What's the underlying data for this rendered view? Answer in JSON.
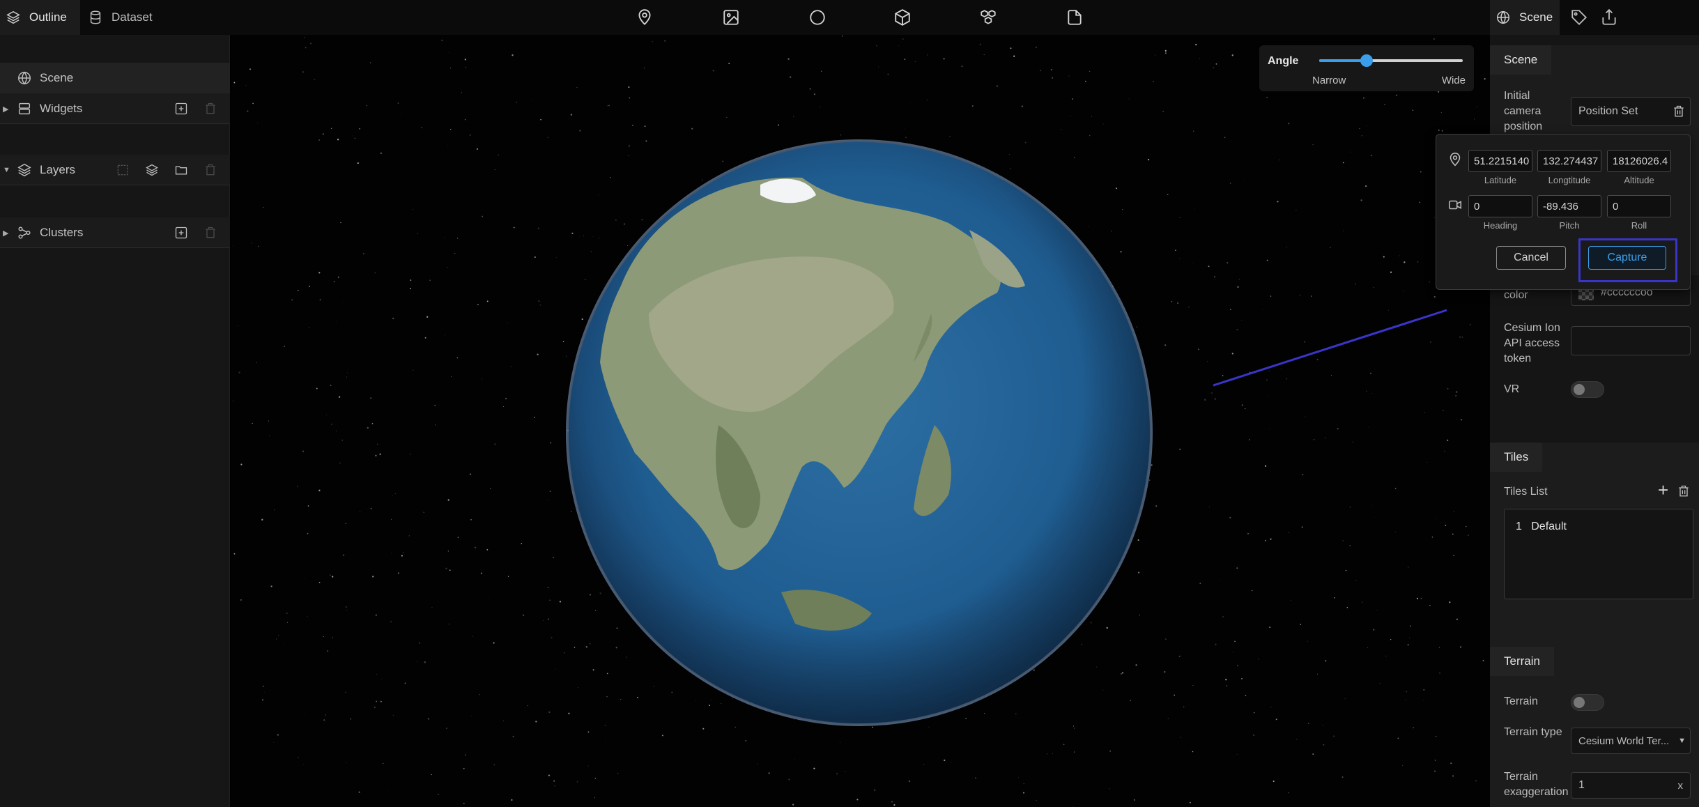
{
  "colors": {
    "accent": "#3b9eea",
    "annotation": "#3a35c9",
    "panel": "#161616",
    "background": "#000000"
  },
  "top_left_tabs": [
    {
      "label": "Outline",
      "icon": "layers-icon",
      "active": true
    },
    {
      "label": "Dataset",
      "icon": "database-icon",
      "active": false
    }
  ],
  "toolbar": [
    "map-pin-icon",
    "image-icon",
    "circle-icon",
    "cube-icon",
    "cubes-icon",
    "file-icon"
  ],
  "top_right_tabs": [
    {
      "label": "Scene",
      "icon": "globe-icon",
      "active": true
    },
    {
      "label": "",
      "icon": "tag-icon",
      "active": false
    },
    {
      "label": "",
      "icon": "publish-icon",
      "active": false
    }
  ],
  "outline": {
    "scene": "Scene",
    "widgets": "Widgets",
    "layers": "Layers",
    "clusters": "Clusters"
  },
  "angle": {
    "label": "Angle",
    "min_label": "Narrow",
    "max_label": "Wide",
    "value_fraction": 0.33
  },
  "right_panel": {
    "scene_section": "Scene",
    "initial_camera_label": "Initial camera position",
    "position_set": "Position Set",
    "bg_color_label": "color",
    "bg_color_value": "#ccccccoo",
    "cesium_label": "Cesium Ion API access token",
    "cesium_value": "",
    "vr_label": "VR",
    "tiles_section": "Tiles",
    "tiles_list_label": "Tiles List",
    "tiles": [
      {
        "index": "1",
        "name": "Default"
      }
    ],
    "terrain_section": "Terrain",
    "terrain_label": "Terrain",
    "terrain_type_label": "Terrain type",
    "terrain_type_value": "Cesium World Ter...",
    "terrain_exag_label": "Terrain exaggeration",
    "terrain_exag_value": "1",
    "terrain_exag_clear": "x"
  },
  "camera_popup": {
    "latitude": "51.2215140",
    "longitude": "132.274437",
    "altitude": "18126026.4",
    "latitude_label": "Latitude",
    "longitude_label": "Longtitude",
    "altitude_label": "Altitude",
    "heading": "0",
    "pitch": "-89.436",
    "roll": "0",
    "heading_label": "Heading",
    "pitch_label": "Pitch",
    "roll_label": "Roll",
    "cancel": "Cancel",
    "capture": "Capture"
  }
}
